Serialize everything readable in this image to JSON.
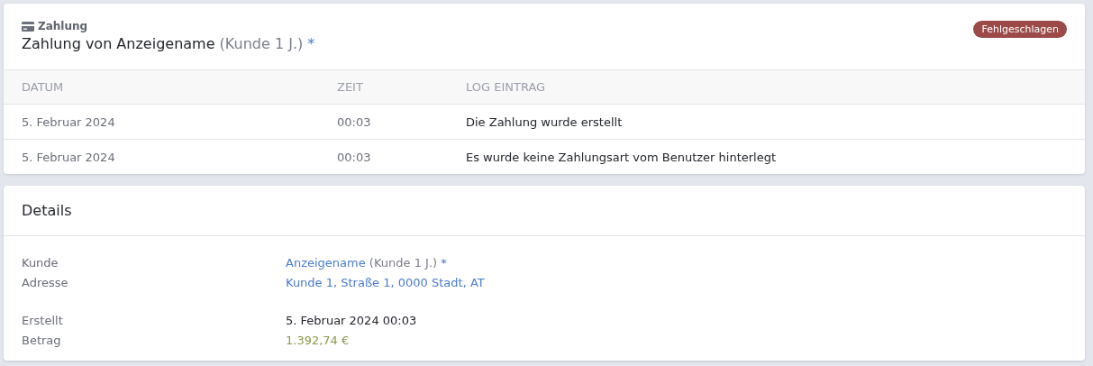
{
  "payment_card": {
    "category": "Zahlung",
    "title": {
      "text": "Zahlung von Anzeigename",
      "suffix": "(Kunde 1 J.)",
      "mark": "*"
    },
    "status": {
      "label": "Fehlgeschlagen",
      "kind": "failed"
    },
    "table": {
      "columns": [
        "DATUM",
        "ZEIT",
        "LOG EINTRAG"
      ],
      "rows": [
        {
          "cells": [
            "5. Februar 2024",
            "00:03",
            "Die Zahlung wurde erstellt"
          ]
        },
        {
          "cells": [
            "5. Februar 2024",
            "00:03",
            "Es wurde keine Zahlungsart vom Benutzer hinterlegt"
          ]
        }
      ]
    }
  },
  "details_card": {
    "title": "Details",
    "groups": [
      [
        {
          "label": "Kunde",
          "kind": "link",
          "value": "Anzeigename",
          "suffix": "(Kunde 1 J.)",
          "mark": "*"
        },
        {
          "label": "Adresse",
          "kind": "link",
          "value": "Kunde 1, Straße 1, 0000 Stadt, AT"
        }
      ],
      [
        {
          "label": "Erstellt",
          "kind": "plain",
          "value": "5. Februar 2024 00:03"
        },
        {
          "label": "Betrag",
          "kind": "amount",
          "value": "1.392,74 €"
        }
      ]
    ]
  }
}
